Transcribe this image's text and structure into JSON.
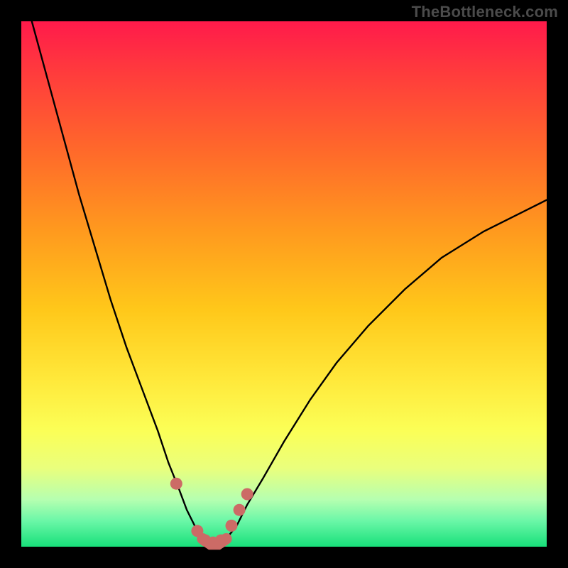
{
  "watermark": "TheBottleneck.com",
  "colors": {
    "background": "#000000",
    "curve_stroke": "#000000",
    "marker_fill": "#cc6b66",
    "gradient_stops": [
      "#ff1a4b",
      "#ff3c3c",
      "#ff6a2a",
      "#ff9a1e",
      "#ffc81a",
      "#ffe83a",
      "#fbff57",
      "#eaff7c",
      "#b6ffb0",
      "#6cf7a8",
      "#18e07a"
    ]
  },
  "chart_data": {
    "type": "line",
    "title": "",
    "xlabel": "",
    "ylabel": "",
    "xlim": [
      0,
      100
    ],
    "ylim": [
      0,
      100
    ],
    "grid": false,
    "legend": false,
    "annotations": [
      "TheBottleneck.com"
    ],
    "series": [
      {
        "name": "left-branch",
        "x": [
          2,
          5,
          8,
          11,
          14,
          17,
          20,
          23,
          26,
          28,
          30,
          31.5,
          33,
          34.5
        ],
        "y": [
          100,
          89,
          78,
          67,
          57,
          47,
          38,
          30,
          22,
          16,
          11,
          7,
          4,
          1.5
        ]
      },
      {
        "name": "right-branch",
        "x": [
          39,
          41,
          43,
          46,
          50,
          55,
          60,
          66,
          73,
          80,
          88,
          96,
          100
        ],
        "y": [
          1.5,
          4,
          8,
          13,
          20,
          28,
          35,
          42,
          49,
          55,
          60,
          64,
          66
        ]
      },
      {
        "name": "valley-floor",
        "x": [
          34.5,
          36,
          37.5,
          39
        ],
        "y": [
          1.5,
          0.5,
          0.5,
          1.5
        ]
      }
    ],
    "markers": {
      "name": "highlighted-points",
      "shape": "circle",
      "color": "#cc6b66",
      "x": [
        29.5,
        33.5,
        35.0,
        36.5,
        38.0,
        40.0,
        41.5,
        43.0
      ],
      "y": [
        12.0,
        3.0,
        1.2,
        0.8,
        1.2,
        4.0,
        7.0,
        10.0
      ]
    }
  }
}
